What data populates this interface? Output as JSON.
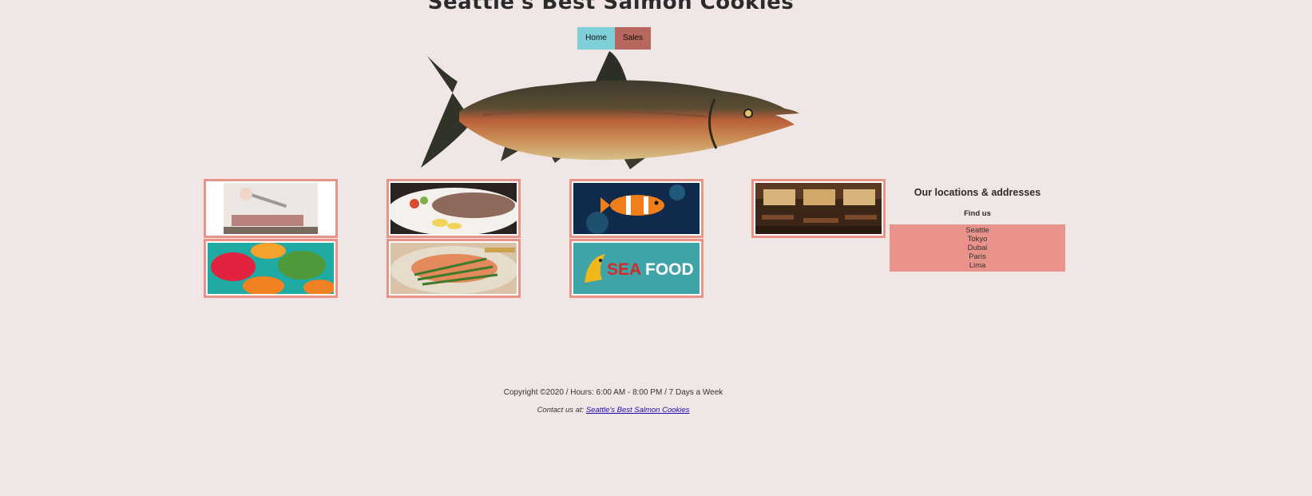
{
  "header": {
    "title": "Seattle's Best Salmon Cookies"
  },
  "nav": {
    "home_label": "Home",
    "sales_label": "Sales",
    "home_color": "#7ecfd8",
    "sales_color": "#b8675e"
  },
  "gallery": {
    "tiles": [
      {
        "subject": "salmon-fillet-slicing-image"
      },
      {
        "subject": "grilled-fish-plate-image"
      },
      {
        "subject": "clownfish-image"
      },
      {
        "subject": "restaurant-interior-image"
      },
      {
        "subject": "fish-shaped-cookies-image"
      },
      {
        "subject": "salmon-dish-image"
      },
      {
        "subject": "seafood-logo-image"
      }
    ],
    "seafood_logo_text": {
      "sea": "SEA",
      "food": "FOOD"
    }
  },
  "locations": {
    "heading": "Our locations & addresses",
    "subheading": "Find us",
    "cities": [
      "Seattle",
      "Tokyo",
      "Dubai",
      "Paris",
      "Lima"
    ]
  },
  "footer": {
    "copyright": "Copyright ©2020 / Hours: 6:00 AM - 8:00 PM / 7 Days a Week",
    "contact_prefix": "Contact us at:",
    "contact_link": "Seattle's Best Salmon Cookies"
  },
  "colors": {
    "background": "#f1e6e6",
    "tile_border": "#ea9488",
    "locations_list_bg": "#e9938a"
  }
}
